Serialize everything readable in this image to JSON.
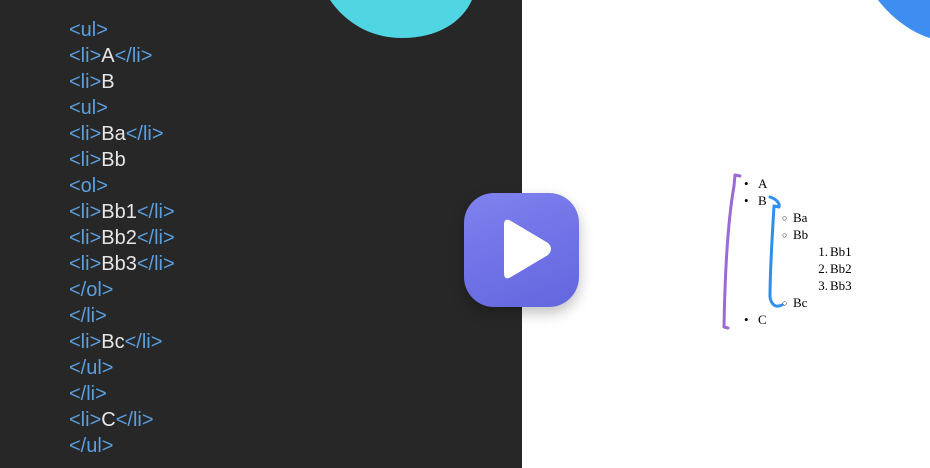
{
  "code": {
    "lines": [
      [
        {
          "t": "tag",
          "v": "<ul>"
        }
      ],
      [
        {
          "t": "tag",
          "v": "<li>"
        },
        {
          "t": "txt",
          "v": "A"
        },
        {
          "t": "tag",
          "v": "</li>"
        }
      ],
      [
        {
          "t": "tag",
          "v": "<li>"
        },
        {
          "t": "txt",
          "v": "B"
        }
      ],
      [
        {
          "t": "tag",
          "v": "<ul>"
        }
      ],
      [
        {
          "t": "tag",
          "v": "<li>"
        },
        {
          "t": "txt",
          "v": "Ba"
        },
        {
          "t": "tag",
          "v": "</li>"
        }
      ],
      [
        {
          "t": "tag",
          "v": "<li>"
        },
        {
          "t": "txt",
          "v": "Bb"
        }
      ],
      [
        {
          "t": "tag",
          "v": "<ol>"
        }
      ],
      [
        {
          "t": "tag",
          "v": "<li>"
        },
        {
          "t": "txt",
          "v": "Bb1"
        },
        {
          "t": "tag",
          "v": "</li>"
        }
      ],
      [
        {
          "t": "tag",
          "v": "<li>"
        },
        {
          "t": "txt",
          "v": "Bb2"
        },
        {
          "t": "tag",
          "v": "</li>"
        }
      ],
      [
        {
          "t": "tag",
          "v": "<li>"
        },
        {
          "t": "txt",
          "v": "Bb3"
        },
        {
          "t": "tag",
          "v": "</li>"
        }
      ],
      [
        {
          "t": "tag",
          "v": "</ol>"
        }
      ],
      [
        {
          "t": "tag",
          "v": "</li>"
        }
      ],
      [
        {
          "t": "tag",
          "v": "<li>"
        },
        {
          "t": "txt",
          "v": "Bc"
        },
        {
          "t": "tag",
          "v": "</li>"
        }
      ],
      [
        {
          "t": "tag",
          "v": "</ul>"
        }
      ],
      [
        {
          "t": "tag",
          "v": "</li>"
        }
      ],
      [
        {
          "t": "tag",
          "v": "<li>"
        },
        {
          "t": "txt",
          "v": "C"
        },
        {
          "t": "tag",
          "v": "</li>"
        }
      ],
      [
        {
          "t": "tag",
          "v": "</ul>"
        }
      ]
    ]
  },
  "preview": {
    "a": "A",
    "b": "B",
    "ba": "Ba",
    "bb": "Bb",
    "bb1_num": "1.",
    "bb1": "Bb1",
    "bb2_num": "2.",
    "bb2": "Bb2",
    "bb3_num": "3.",
    "bb3": "Bb3",
    "bc": "Bc",
    "c": "C",
    "bullet_disc": "•",
    "bullet_circle": "○"
  },
  "colors": {
    "code_bg": "#272727",
    "tag": "#5a9fe0",
    "text": "#e6e6e6",
    "accent_cyan": "#4fd6e2",
    "accent_blue": "#3d8ef0",
    "bracket_purple": "#9b6ad6",
    "bracket_blue": "#2f8ff0",
    "play_button": "#7173e8"
  },
  "play_button": {
    "icon": "play-icon"
  }
}
